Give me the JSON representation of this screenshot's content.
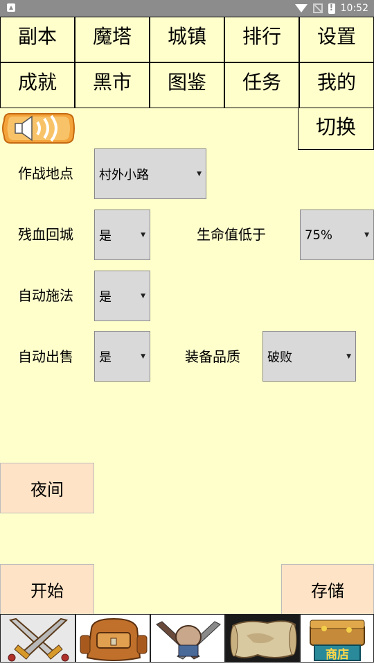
{
  "status_bar": {
    "time": "10:52"
  },
  "nav": {
    "row1": [
      "副本",
      "魔塔",
      "城镇",
      "排行",
      "设置"
    ],
    "row2": [
      "成就",
      "黑市",
      "图鉴",
      "任务",
      "我的"
    ]
  },
  "switch_label": "切换",
  "settings": {
    "battle_location_label": "作战地点",
    "battle_location_value": "村外小路",
    "low_hp_return_label": "残血回城",
    "low_hp_return_value": "是",
    "hp_below_label": "生命值低于",
    "hp_below_value": "75%",
    "auto_cast_label": "自动施法",
    "auto_cast_value": "是",
    "auto_sell_label": "自动出售",
    "auto_sell_value": "是",
    "equip_quality_label": "装备品质",
    "equip_quality_value": "破败"
  },
  "buttons": {
    "night": "夜间",
    "start": "开始",
    "save": "存储"
  },
  "bottom_tiles": [
    "swords-icon",
    "backpack-icon",
    "fist-weapons-icon",
    "scroll-map-icon",
    "shop-chest-icon"
  ],
  "shop_sign_text": "商店"
}
